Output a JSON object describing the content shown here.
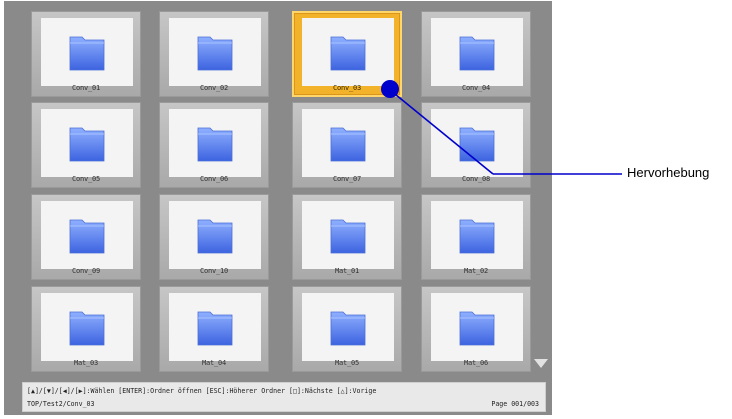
{
  "folders": [
    {
      "name": "Conv_01",
      "selected": false
    },
    {
      "name": "Conv_02",
      "selected": false
    },
    {
      "name": "Conv_03",
      "selected": true
    },
    {
      "name": "Conv_04",
      "selected": false
    },
    {
      "name": "Conv_05",
      "selected": false
    },
    {
      "name": "Conv_06",
      "selected": false
    },
    {
      "name": "Conv_07",
      "selected": false
    },
    {
      "name": "Conv_08",
      "selected": false
    },
    {
      "name": "Conv_09",
      "selected": false
    },
    {
      "name": "Conv_10",
      "selected": false
    },
    {
      "name": "Mat_01",
      "selected": false
    },
    {
      "name": "Mat_02",
      "selected": false
    },
    {
      "name": "Mat_03",
      "selected": false
    },
    {
      "name": "Mat_04",
      "selected": false
    },
    {
      "name": "Mat_05",
      "selected": false
    },
    {
      "name": "Mat_06",
      "selected": false
    }
  ],
  "status": {
    "help": "[▲]/[▼]/[◀]/[▶]:Wählen [ENTER]:Ordner öffnen [ESC]:Höherer Ordner [□]:Nächste [△]:Vorige",
    "path": "TOP/Test2/Conv_03",
    "page": "Page 001/003"
  },
  "callout": {
    "label": "Hervorhebung"
  },
  "icons": {
    "folder": "folder-icon",
    "scroll": "scroll-down-arrow-icon",
    "callout_dot": "callout-dot-icon"
  },
  "colors": {
    "selection": "#f2b32a",
    "callout": "#0000cc",
    "background": "#8a8a8a"
  }
}
